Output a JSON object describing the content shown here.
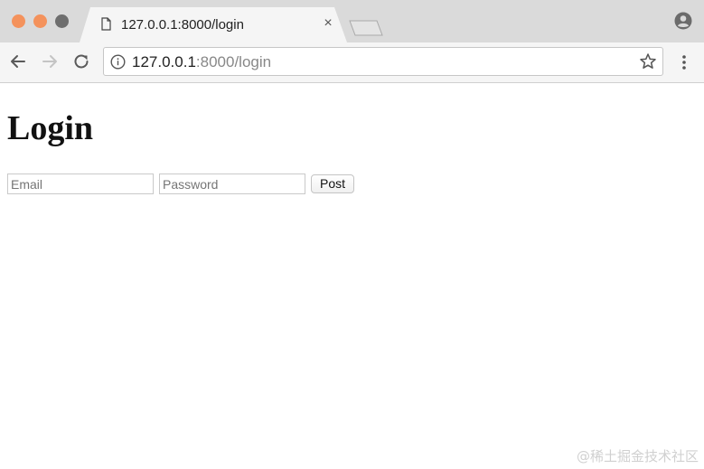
{
  "browser": {
    "tab": {
      "title": "127.0.0.1:8000/login",
      "close_glyph": "×",
      "icon": "document-icon"
    },
    "address_bar": {
      "host": "127.0.0.1",
      "path": ":8000/login",
      "info_icon": "info-icon",
      "bookmark_icon": "star-icon"
    },
    "nav": {
      "back_icon": "arrow-left-icon",
      "forward_icon": "arrow-right-icon",
      "reload_icon": "reload-icon"
    },
    "profile_icon": "account-icon",
    "menu_icon": "kebab-menu-icon",
    "window_controls": {
      "close_color": "#f4925c",
      "minimize_color": "#f4925c",
      "maximize_color": "#6e6e6e"
    }
  },
  "page": {
    "title": "Login",
    "form": {
      "email": {
        "value": "",
        "placeholder": "Email"
      },
      "password": {
        "value": "",
        "placeholder": "Password"
      },
      "submit_label": "Post"
    }
  },
  "watermark": "@稀土掘金技术社区"
}
